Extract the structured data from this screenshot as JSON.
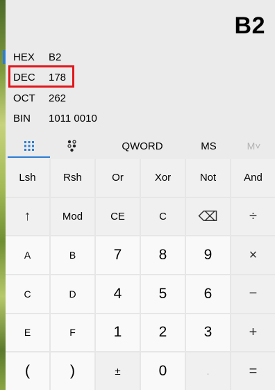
{
  "display": {
    "value": "B2"
  },
  "radix": {
    "hex": {
      "label": "HEX",
      "value": "B2"
    },
    "dec": {
      "label": "DEC",
      "value": "178"
    },
    "oct": {
      "label": "OCT",
      "value": "262"
    },
    "bin": {
      "label": "BIN",
      "value": "1011 0010"
    }
  },
  "modes": {
    "keypad_icon": "keypad-icon",
    "bit_toggle_icon": "bit-toggle-icon",
    "word_size": "QWORD",
    "memory_store": "MS",
    "memory_view": "M˅"
  },
  "keys": {
    "row1": [
      "Lsh",
      "Rsh",
      "Or",
      "Xor",
      "Not",
      "And"
    ],
    "row2": [
      "↑",
      "Mod",
      "CE",
      "C",
      "⌫",
      "÷"
    ],
    "row3": [
      "A",
      "B",
      "7",
      "8",
      "9",
      "×"
    ],
    "row4": [
      "C",
      "D",
      "4",
      "5",
      "6",
      "−"
    ],
    "row5": [
      "E",
      "F",
      "1",
      "2",
      "3",
      "+"
    ],
    "row6": [
      "(",
      ")",
      "±",
      "0",
      ".",
      "="
    ]
  },
  "colors": {
    "accent": "#2b7cd3",
    "highlight_box": "#e0161b"
  }
}
